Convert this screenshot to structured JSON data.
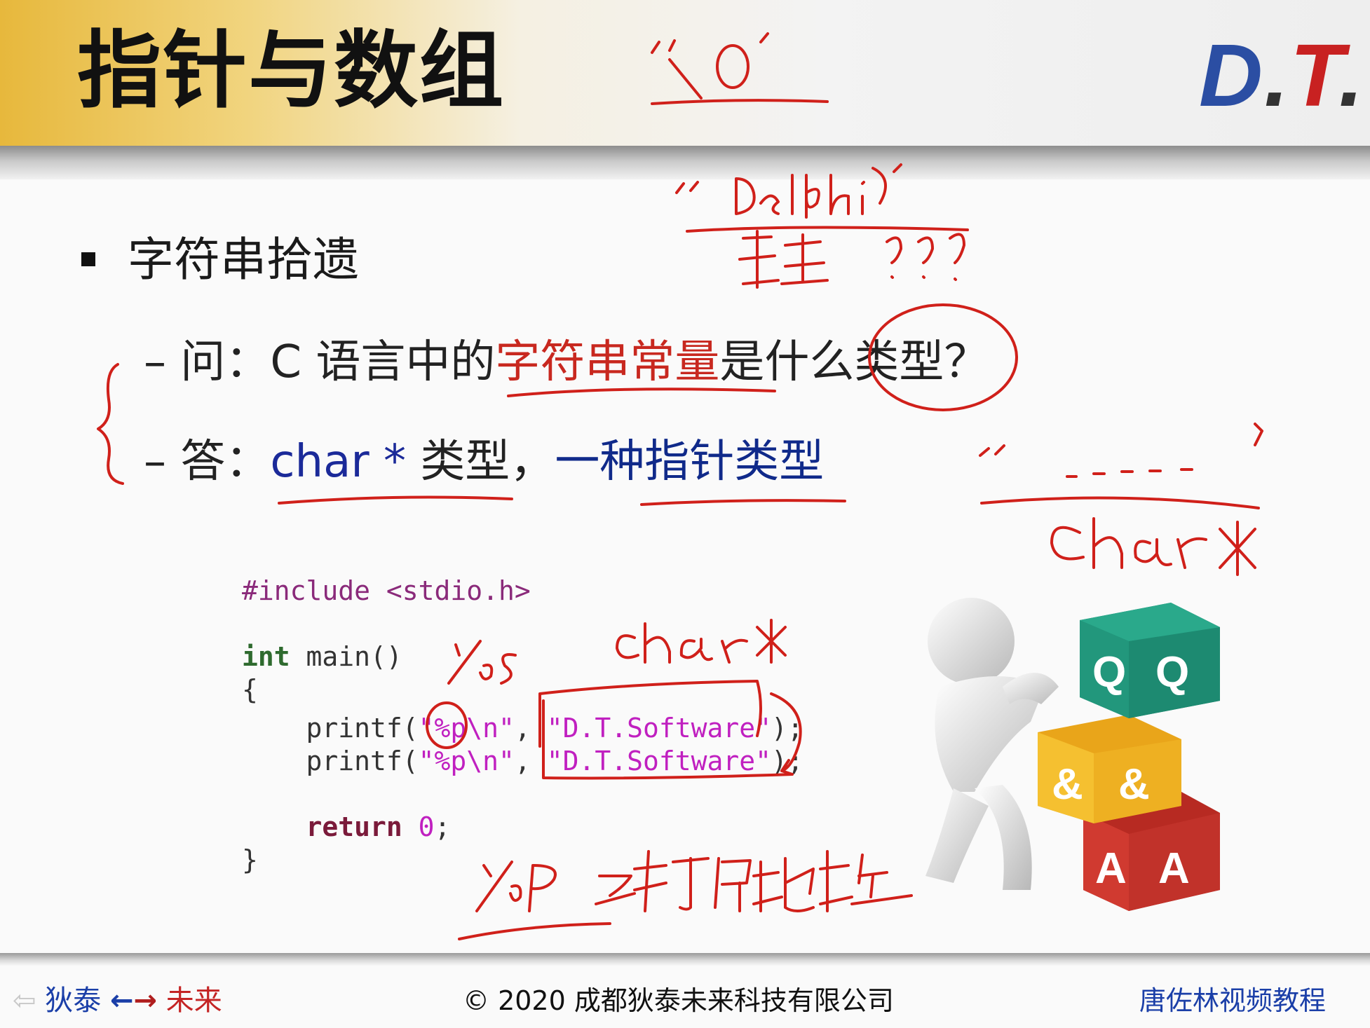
{
  "slide": {
    "title": "指针与数组",
    "logo": {
      "d": "D",
      "dot1": ".",
      "t": "T",
      "dot2": "."
    },
    "bullet": "字符串拾遗",
    "qa": {
      "q_dash": "–",
      "q_prefix": "问：C 语言中的",
      "q_highlight": "字符串常量",
      "q_suffix": "是什么类型？",
      "a_dash": "–",
      "a_prefix": "答：",
      "a_char": "char",
      "a_star": " * ",
      "a_type": "类型，",
      "a_tail": "一种指针类型"
    }
  },
  "code": {
    "line1": "#include <stdio.h>",
    "line3_kw": "int",
    "line3_rest": " main()",
    "line4": "{",
    "line5_pre": "    printf(",
    "line5_fmt": "\"%p\\n\"",
    "line5_mid": ", ",
    "line5_str": "\"D.T.Software\"",
    "line5_end": ");",
    "line6_pre": "    printf(",
    "line6_fmt": "\"%p\\n\"",
    "line6_mid": ", ",
    "line6_str": "\"D.T.Software\"",
    "line6_end": ");",
    "line8_kw": "    return",
    "line8_sp": " ",
    "line8_num": "0",
    "line8_end": ";",
    "line9": "}"
  },
  "illustration": {
    "cube_labels": [
      "Q",
      "Q",
      "&",
      "&",
      "A",
      "A"
    ],
    "cube_colors": {
      "teal": "#1f8f76",
      "yellow": "#f2b31f",
      "red": "#c9322a"
    }
  },
  "annotations": {
    "ink_color": "#d0201a",
    "texts": [
      "'\\0'",
      "\"Delphi\"",
      "类型???",
      "%s",
      "char*",
      "char*",
      "%P → 打印地址"
    ]
  },
  "footer": {
    "left_arrow": "⇦",
    "left_a": "狄泰",
    "left_arrow_l": "←",
    "left_arrow_r": "→",
    "left_b": "未来",
    "center": "© 2020 成都狄泰未来科技有限公司",
    "right": "唐佐林视频教程"
  }
}
